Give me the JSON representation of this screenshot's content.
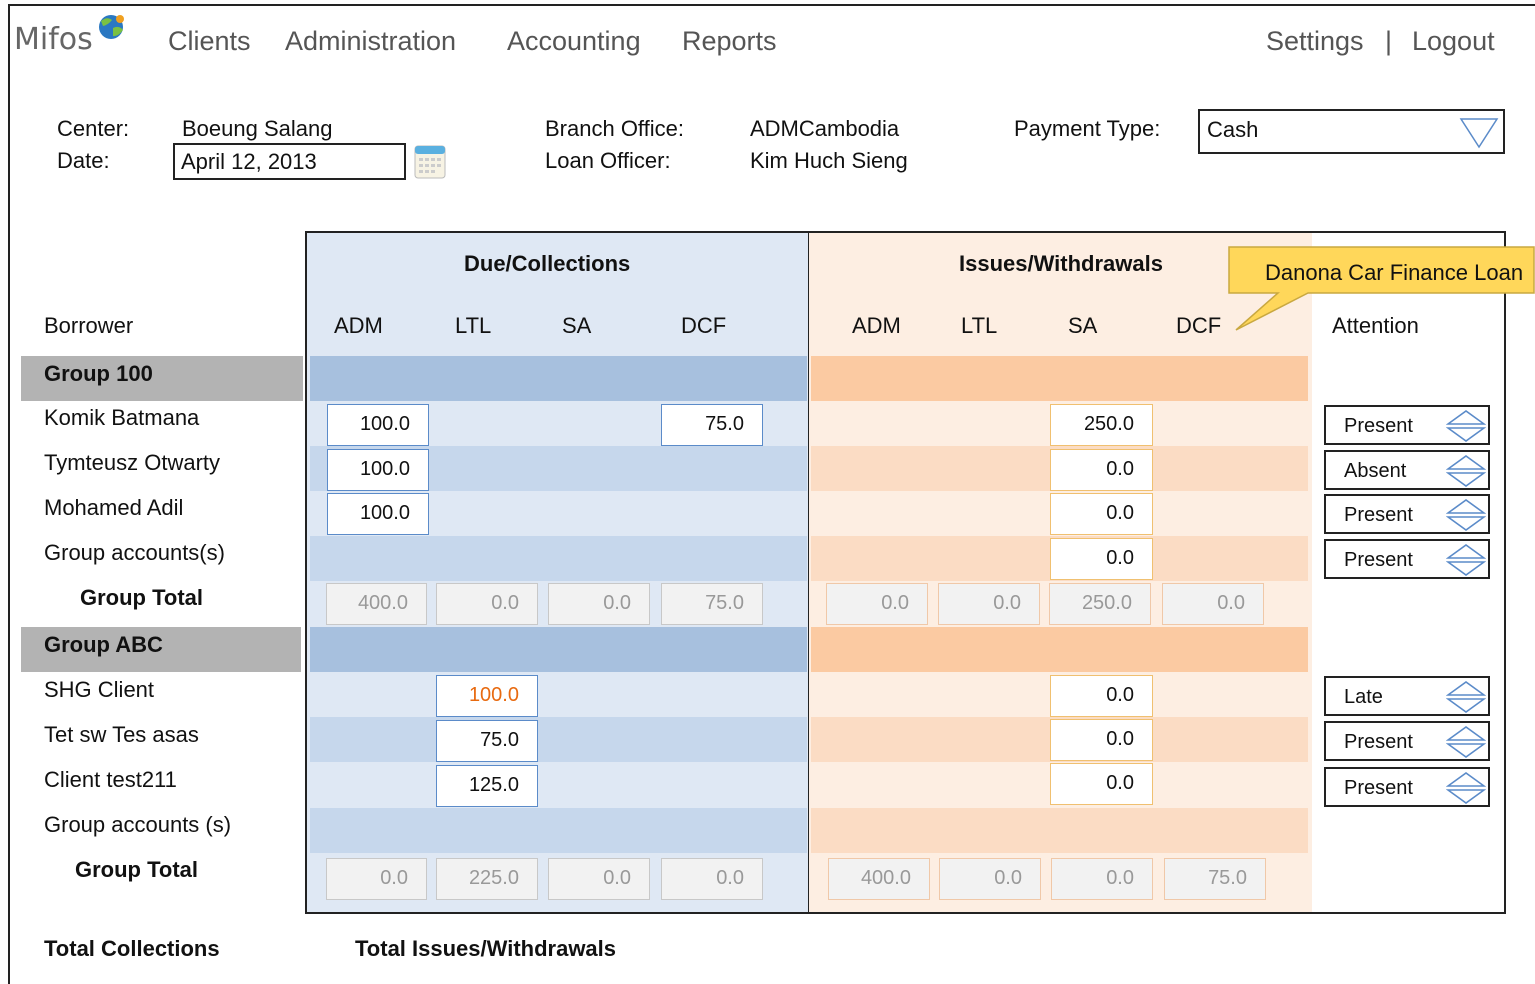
{
  "app": {
    "logo_text": "Mifos"
  },
  "nav": {
    "clients": "Clients",
    "administration": "Administration",
    "accounting": "Accounting",
    "reports": "Reports",
    "settings": "Settings",
    "separator": "|",
    "logout": "Logout"
  },
  "form": {
    "center_label": "Center:",
    "center_value": "Boeung Salang",
    "date_label": "Date:",
    "date_value": "April 12, 2013",
    "branch_label": "Branch Office:",
    "branch_value": "ADMCambodia",
    "officer_label": "Loan Officer:",
    "officer_value": "Kim Huch Sieng",
    "payment_label": "Payment Type:",
    "payment_value": "Cash"
  },
  "table": {
    "due_header": "Due/Collections",
    "issues_header": "Issues/Withdrawals",
    "borrower_header": "Borrower",
    "attention_header": "Attention",
    "due_cols": [
      "ADM",
      "LTL",
      "SA",
      "DCF"
    ],
    "issue_cols": [
      "ADM",
      "LTL",
      "SA",
      "DCF"
    ],
    "tooltip": "Danona Car Finance Loan",
    "groups": [
      {
        "name": "Group 100",
        "rows": [
          {
            "label": "Komik Batmana",
            "due": [
              "100.0",
              "",
              "",
              "75.0"
            ],
            "issue_sa": "250.0",
            "attention": "Present"
          },
          {
            "label": "Tymteusz Otwarty",
            "due": [
              "100.0",
              "",
              "",
              ""
            ],
            "issue_sa": "0.0",
            "attention": "Absent"
          },
          {
            "label": "Mohamed Adil",
            "due": [
              "100.0",
              "",
              "",
              ""
            ],
            "issue_sa": "0.0",
            "attention": "Present"
          },
          {
            "label": "Group accounts(s)",
            "due": [
              "",
              "",
              "",
              ""
            ],
            "issue_sa": "0.0",
            "attention": "Present"
          }
        ],
        "total_label": "Group Total",
        "due_totals": [
          "400.0",
          "0.0",
          "0.0",
          "75.0"
        ],
        "issue_totals": [
          "0.0",
          "0.0",
          "250.0",
          "0.0"
        ]
      },
      {
        "name": "Group ABC",
        "rows": [
          {
            "label": "SHG Client",
            "due": [
              "",
              "100.0",
              "",
              ""
            ],
            "issue_sa": "0.0",
            "attention": "Late"
          },
          {
            "label": "Tet sw Tes asas",
            "due": [
              "",
              "75.0",
              "",
              ""
            ],
            "issue_sa": "0.0",
            "attention": "Present"
          },
          {
            "label": "Client test211",
            "due": [
              "",
              "125.0",
              "",
              ""
            ],
            "issue_sa": "0.0",
            "attention": "Present"
          },
          {
            "label": "Group accounts (s)",
            "due": [
              "",
              "",
              "",
              ""
            ],
            "issue_sa": "",
            "attention": ""
          }
        ],
        "total_label": "Group Total",
        "due_totals": [
          "0.0",
          "225.0",
          "0.0",
          "0.0"
        ],
        "issue_totals": [
          "400.0",
          "0.0",
          "0.0",
          "75.0"
        ]
      }
    ],
    "total_collections": "Total Collections",
    "total_issues": "Total Issues/Withdrawals"
  },
  "colors": {
    "blue_panel": "#dfe8f4",
    "blue_band": "#a7c0de",
    "blue_row": "#c6d7ec",
    "peach_panel": "#fdeee2",
    "peach_band": "#fbcaa2",
    "peach_row": "#fbdcc4",
    "warning": "#e86a10"
  }
}
